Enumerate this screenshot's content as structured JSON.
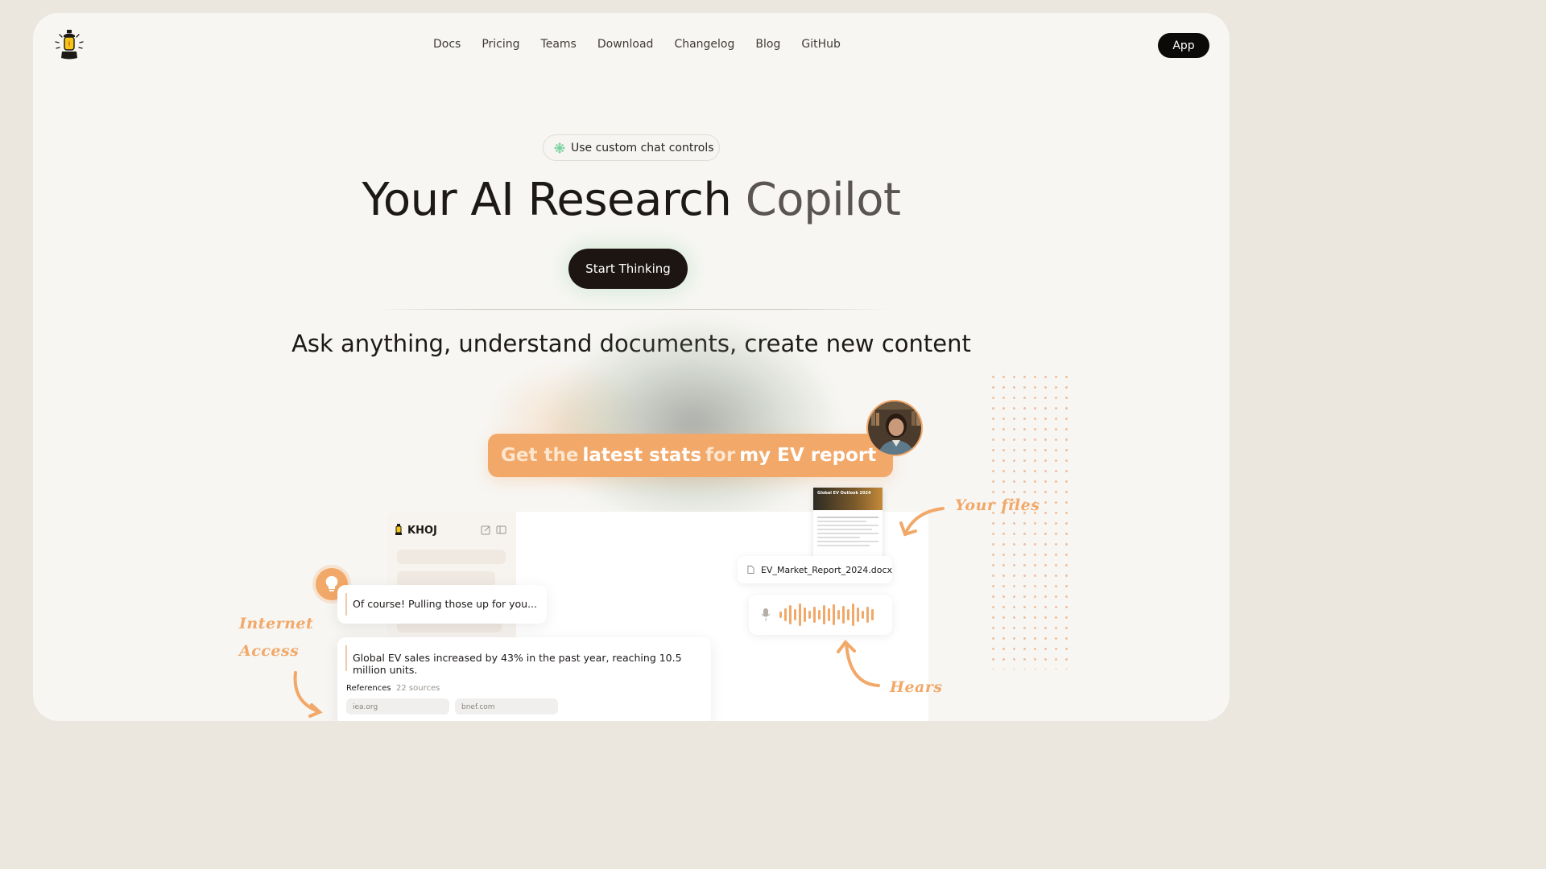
{
  "nav": {
    "links": [
      "Docs",
      "Pricing",
      "Teams",
      "Download",
      "Changelog",
      "Blog",
      "GitHub"
    ],
    "app_button": "App"
  },
  "hero": {
    "pill_text": "Use custom chat controls",
    "title_dark": "Your AI Research",
    "title_muted": "Copilot",
    "cta": "Start Thinking",
    "subtitle": "Ask anything, understand documents, create new content"
  },
  "demo": {
    "query": {
      "part1": "Get the",
      "bold1": "latest stats",
      "part2": "for",
      "bold2": "my EV report"
    },
    "brand": "KHOJ",
    "reply_short": "Of course! Pulling those up for you...",
    "reply_long": "Global EV sales increased by 43% in the past year, reaching 10.5 million units.",
    "references_label": "References",
    "sources_count": "22 sources",
    "ref1": "iea.org",
    "ref2": "bnef.com",
    "file_name": "EV_Market_Report_2024.docx",
    "doc_title": "Global EV Outlook 2024",
    "annotations": {
      "internet": "Internet",
      "access": "Access",
      "files": "Your files",
      "hears": "Hears"
    }
  },
  "colors": {
    "accent": "#f2a868",
    "dark": "#1c1512",
    "bg": "#f7f6f3"
  },
  "icons": [
    "lantern-icon",
    "sparkle-icon",
    "bulb-icon",
    "edit-icon",
    "sidebar-icon",
    "file-icon",
    "mic-icon",
    "arrow-icon"
  ]
}
